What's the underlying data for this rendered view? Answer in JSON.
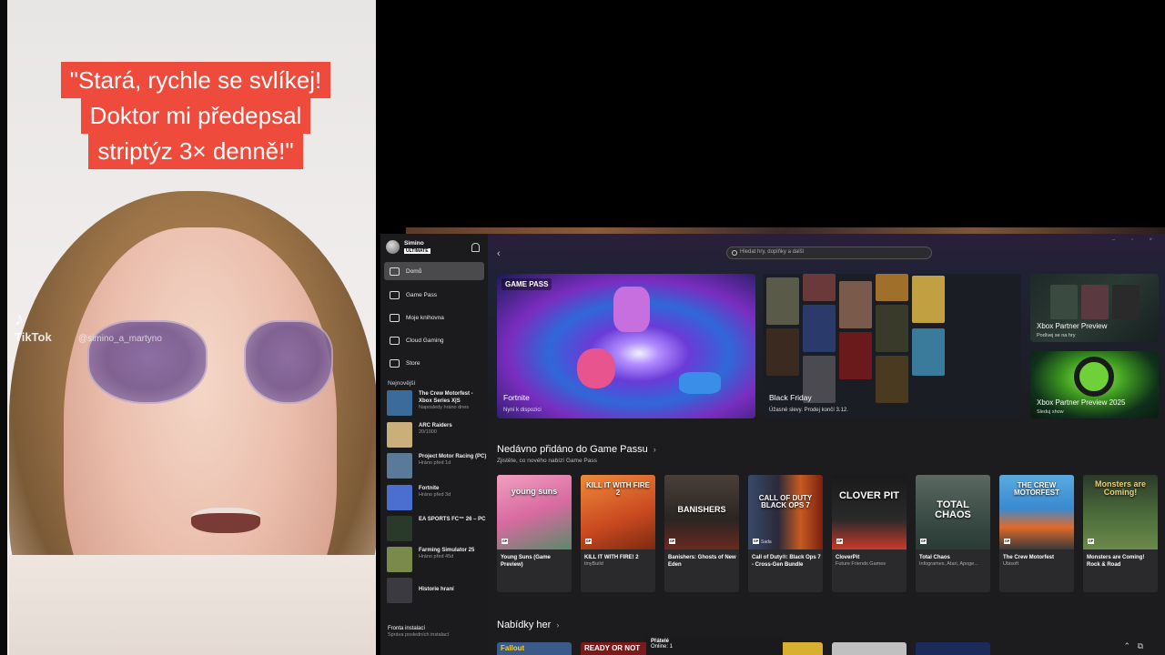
{
  "video": {
    "caption_lines": [
      "\"Stará, rychle se svlíkej!",
      "Doktor mi předepsal",
      "striptýz 3× denně!\""
    ],
    "brand": "TikTok",
    "handle": "@simino_a_martyno"
  },
  "app": {
    "profile": {
      "name": "Simino",
      "badge": "ULTIMATE"
    },
    "nav": [
      {
        "label": "Domů",
        "icon": "home-icon"
      },
      {
        "label": "Game Pass",
        "icon": "gamepass-icon"
      },
      {
        "label": "Moje knihovna",
        "icon": "library-icon"
      },
      {
        "label": "Cloud Gaming",
        "icon": "cloud-icon"
      },
      {
        "label": "Store",
        "icon": "store-icon"
      }
    ],
    "recent_title": "Nejnovější",
    "recent": [
      {
        "title": "The Crew Motorfest - Xbox Series X|S",
        "sub": "Naposledy hráno dnes",
        "color": "#3a6b9a"
      },
      {
        "title": "ARC Raiders",
        "sub": "20/1000",
        "color": "#c9b07a"
      },
      {
        "title": "Project Motor Racing (PC)",
        "sub": "Hráno před 1d",
        "color": "#5a7a9a"
      },
      {
        "title": "Fortnite",
        "sub": "Hráno před 3d",
        "color": "#4a6fd0"
      },
      {
        "title": "EA SPORTS FC™ 26 – PC",
        "sub": "",
        "color": "#2a3a2a"
      },
      {
        "title": "Farming Simulator 25",
        "sub": "Hráno před 45d",
        "color": "#7a8a4a"
      },
      {
        "title": "Historie hraní",
        "sub": "",
        "color": "#3a3a40"
      }
    ],
    "install": {
      "title": "Fronta instalací",
      "sub": "Správa posledních instalací"
    },
    "search_placeholder": "Hledat hry, doplňky a další",
    "heroes": {
      "gamepass_badge": "GAME PASS",
      "fortnite": {
        "title": "Fortnite",
        "sub": "Nyní k dispozici"
      },
      "black_friday": {
        "title": "Black Friday",
        "sub": "Úžasné slevy. Prodej končí 3.12."
      },
      "partner1": {
        "title": "Xbox Partner Preview",
        "sub": "Podívej se na hry"
      },
      "partner2": {
        "title": "Xbox Partner Preview 2025",
        "sub": "Sleduj show"
      }
    },
    "section1": {
      "title": "Nedávno přidáno do Game Passu",
      "sub": "Zjistěte, co nového nabízí Game Pass"
    },
    "cards": [
      {
        "title": "Young Suns (Game Preview)",
        "sub": "",
        "art": "young suns",
        "bg": "#e07aa0"
      },
      {
        "title": "KILL IT WITH FIRE! 2",
        "sub": "tinyBuild",
        "art": "KILL IT WITH FIRE 2",
        "bg": "#d9582a"
      },
      {
        "title": "Banishers: Ghosts of New Eden",
        "sub": "",
        "art": "BANISHERS",
        "bg": "#3a3330"
      },
      {
        "title": "Call of Duty®: Black Ops 7 - Cross-Gen Bundle",
        "sub": "",
        "art": "CALL OF DUTY BLACK OPS 7",
        "bg": "#8a3a20",
        "bundle": "Sada"
      },
      {
        "title": "CloverPit",
        "sub": "Future Friends Games",
        "art": "CLOVER PIT",
        "bg": "#1a1a1a"
      },
      {
        "title": "Total Chaos",
        "sub": "Infogrames, Atari, Apoge...",
        "art": "TOTAL CHAOS",
        "bg": "#4a5a52"
      },
      {
        "title": "The Crew Motorfest",
        "sub": "Ubisoft",
        "art": "THE CREW MOTORFEST",
        "bg": "#3a8ad0"
      },
      {
        "title": "Monsters are Coming! Rock & Road",
        "sub": "",
        "art": "Monsters are Coming!",
        "bg": "#4a6a3a"
      }
    ],
    "section2": {
      "title": "Nabídky her"
    },
    "row2": [
      {
        "title": "Fallout",
        "bg": "#3a5a8a"
      },
      {
        "title": "READY OR NOT",
        "bg": "#7a1a1a"
      },
      {
        "title": "",
        "bg": "#9aa0a6"
      },
      {
        "title": "",
        "bg": "#d8b030"
      },
      {
        "title": "",
        "bg": "#c0c0c0"
      },
      {
        "title": "",
        "bg": "#1a2a5a"
      }
    ],
    "friends": {
      "title": "Přátelé",
      "status": "Online: 1"
    }
  }
}
